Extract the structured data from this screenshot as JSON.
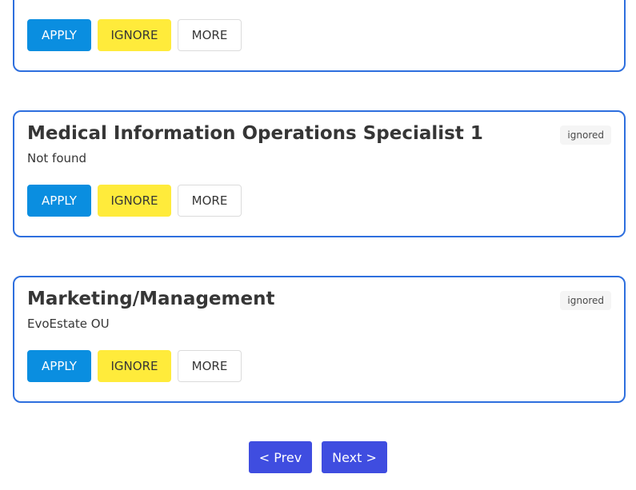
{
  "jobs": [
    {
      "title": "",
      "company": "",
      "status": "",
      "buttons": {
        "apply": "APPLY",
        "ignore": "IGNORE",
        "more": "MORE"
      }
    },
    {
      "title": "Medical Information Operations Specialist 1",
      "company": "Not found",
      "status": "ignored",
      "buttons": {
        "apply": "APPLY",
        "ignore": "IGNORE",
        "more": "MORE"
      }
    },
    {
      "title": "Marketing/Management",
      "company": "EvoEstate OU",
      "status": "ignored",
      "buttons": {
        "apply": "APPLY",
        "ignore": "IGNORE",
        "more": "MORE"
      }
    }
  ],
  "pagination": {
    "prev_label": "< Prev",
    "next_label": "Next >"
  },
  "colors": {
    "card_border": "#2e6fde",
    "apply": "#0a8ee0",
    "ignore": "#ffeb3b",
    "pagination": "#3f4de0"
  }
}
